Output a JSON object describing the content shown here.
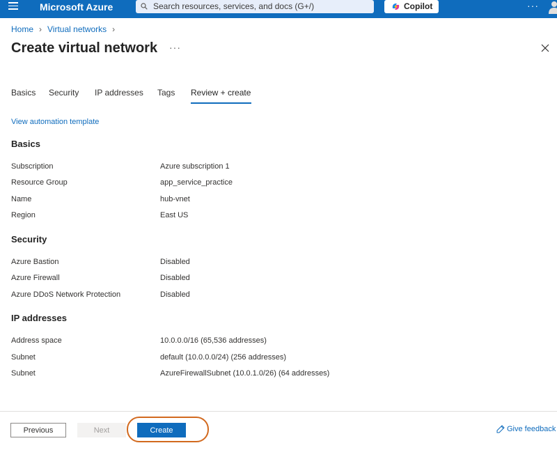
{
  "topbar": {
    "brand": "Microsoft Azure",
    "search_placeholder": "Search resources, services, and docs (G+/)",
    "copilot_label": "Copilot",
    "more_label": "···",
    "accent_color": "#0f6cbd"
  },
  "breadcrumb": {
    "items": [
      "Home",
      "Virtual networks"
    ]
  },
  "page": {
    "title": "Create virtual network",
    "more_label": "···"
  },
  "tabs": [
    {
      "label": "Basics"
    },
    {
      "label": "Security"
    },
    {
      "label": "IP addresses"
    },
    {
      "label": "Tags"
    },
    {
      "label": "Review + create",
      "active": true
    }
  ],
  "automation_link": "View automation template",
  "sections": {
    "basics": {
      "title": "Basics",
      "rows": [
        {
          "label": "Subscription",
          "value": "Azure subscription 1"
        },
        {
          "label": "Resource Group",
          "value": "app_service_practice"
        },
        {
          "label": "Name",
          "value": "hub-vnet"
        },
        {
          "label": "Region",
          "value": "East US"
        }
      ]
    },
    "security": {
      "title": "Security",
      "rows": [
        {
          "label": "Azure Bastion",
          "value": "Disabled"
        },
        {
          "label": "Azure Firewall",
          "value": "Disabled"
        },
        {
          "label": "Azure DDoS Network Protection",
          "value": "Disabled"
        }
      ]
    },
    "ip_addresses": {
      "title": "IP addresses",
      "rows": [
        {
          "label": "Address space",
          "value": "10.0.0.0/16 (65,536 addresses)"
        },
        {
          "label": "Subnet",
          "value": "default (10.0.0.0/24) (256 addresses)"
        },
        {
          "label": "Subnet",
          "value": "AzureFirewallSubnet (10.0.1.0/26) (64 addresses)"
        }
      ]
    }
  },
  "footer": {
    "previous_label": "Previous",
    "next_label": "Next",
    "create_label": "Create",
    "feedback_label": "Give feedback",
    "highlight_color": "#d2691e"
  }
}
